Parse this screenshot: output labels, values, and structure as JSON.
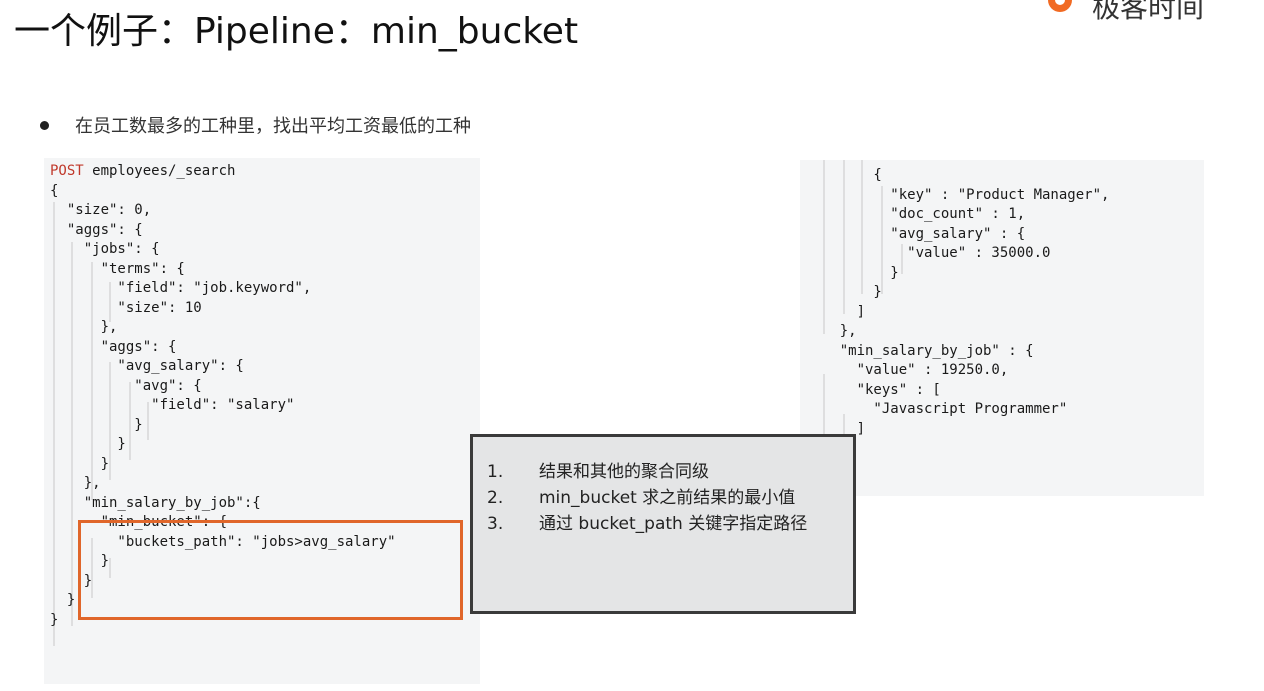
{
  "title": "一个例子：Pipeline：min_bucket",
  "logo": {
    "text": "极客时间",
    "accent": "#f16a23"
  },
  "bullet": "在员工数最多的工种里，找出平均工资最低的工种",
  "left_code": [
    "POST employees/_search",
    "{",
    "  \"size\": 0,",
    "  \"aggs\": {",
    "    \"jobs\": {",
    "      \"terms\": {",
    "        \"field\": \"job.keyword\",",
    "        \"size\": 10",
    "      },",
    "      \"aggs\": {",
    "        \"avg_salary\": {",
    "          \"avg\": {",
    "            \"field\": \"salary\"",
    "          }",
    "        }",
    "      }",
    "    },",
    "    \"min_salary_by_job\":{",
    "      \"min_bucket\": {",
    "        \"buckets_path\": \"jobs>avg_salary\"",
    "      }",
    "    }",
    "  }",
    "}"
  ],
  "right_code": [
    "        {",
    "          \"key\" : \"Product Manager\",",
    "          \"doc_count\" : 1,",
    "          \"avg_salary\" : {",
    "            \"value\" : 35000.0",
    "          }",
    "        }",
    "      ]",
    "    },",
    "    \"min_salary_by_job\" : {",
    "      \"value\" : 19250.0,",
    "      \"keys\" : [",
    "        \"Javascript Programmer\"",
    "      ]"
  ],
  "callout": [
    {
      "num": "1.",
      "text": "结果和其他的聚合同级"
    },
    {
      "num": "2.",
      "text": "min_bucket 求之前结果的最小值"
    },
    {
      "num": "3.",
      "text": "通过 bucket_path 关键字指定路径"
    }
  ],
  "colors": {
    "highlight_border": "#e0662a",
    "callout_border": "#3a3a3a",
    "code_bg": "#f4f5f6"
  }
}
